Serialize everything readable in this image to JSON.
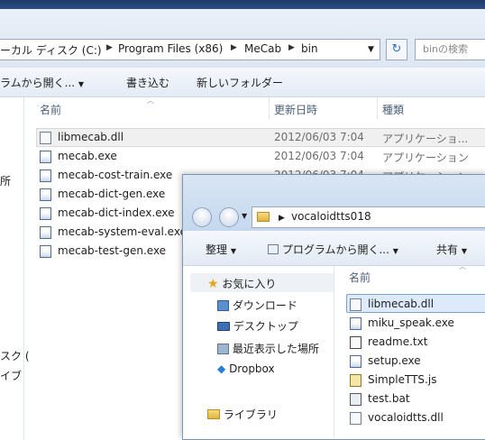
{
  "back": {
    "breadcrumbs": [
      "ーカル ディスク (C:)",
      "Program Files (x86)",
      "MeCab",
      "bin"
    ],
    "search_placeholder": "binの検索",
    "toolbar": {
      "open_with": "ラムから開く...",
      "burn": "書き込む",
      "new_folder": "新しいフォルダー"
    },
    "columns": {
      "name": "名前",
      "modified": "更新日時",
      "type": "種類"
    },
    "left_fragments": [
      "所",
      "スク (",
      "イブ"
    ],
    "files": [
      {
        "name": "libmecab.dll",
        "date": "2012/06/03 7:04",
        "type": "アプリケーショ..."
      },
      {
        "name": "mecab.exe",
        "date": "2012/06/03 7:04",
        "type": "アプリケーション"
      },
      {
        "name": "mecab-cost-train.exe",
        "date": "2012/06/03 7:04",
        "type": "アプリケーション"
      },
      {
        "name": "mecab-dict-gen.exe"
      },
      {
        "name": "mecab-dict-index.exe"
      },
      {
        "name": "mecab-system-eval.exe"
      },
      {
        "name": "mecab-test-gen.exe"
      }
    ]
  },
  "front": {
    "folder": "vocaloidtts018",
    "toolbar": {
      "organize": "整理",
      "open_with": "プログラムから開く...",
      "share": "共有"
    },
    "column_name": "名前",
    "nav": [
      {
        "label": "お気に入り",
        "icon": "star-icon"
      },
      {
        "label": "ダウンロード",
        "icon": "download-folder-icon"
      },
      {
        "label": "デスクトップ",
        "icon": "desktop-icon"
      },
      {
        "label": "最近表示した場所",
        "icon": "recent-places-icon"
      },
      {
        "label": "Dropbox",
        "icon": "dropbox-icon"
      },
      {
        "label": "ライブラリ",
        "icon": "library-icon"
      }
    ],
    "files": [
      "libmecab.dll",
      "miku_speak.exe",
      "readme.txt",
      "setup.exe",
      "SimpleTTS.js",
      "test.bat",
      "vocaloidtts.dll"
    ]
  }
}
